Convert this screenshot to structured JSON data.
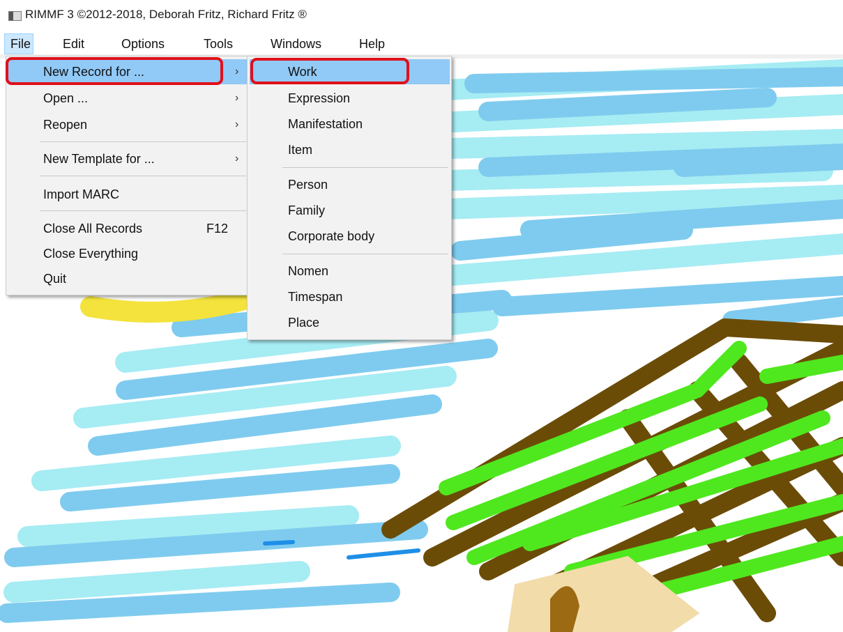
{
  "window": {
    "title": "RIMMF 3   ©2012-2018, Deborah Fritz, Richard Fritz ®"
  },
  "menubar": {
    "items": [
      "File",
      "Edit",
      "Options",
      "Tools",
      "Windows",
      "Help"
    ],
    "active": "File"
  },
  "file_menu": {
    "items": [
      {
        "label": "New Record for ...",
        "shortcut": "",
        "submenu": true,
        "highlighted": true
      },
      {
        "label": "Open ...",
        "shortcut": "",
        "submenu": true
      },
      {
        "label": "Reopen",
        "shortcut": "",
        "submenu": true
      },
      {
        "label": "New Template for ...",
        "shortcut": "",
        "submenu": true
      },
      {
        "label": "Import MARC",
        "shortcut": "",
        "submenu": false
      },
      {
        "label": "Close All Records",
        "shortcut": "F12",
        "submenu": false
      },
      {
        "label": "Close Everything",
        "shortcut": "",
        "submenu": false
      },
      {
        "label": "Quit",
        "shortcut": "",
        "submenu": false
      }
    ],
    "arrow_glyph": "›"
  },
  "new_record_submenu": {
    "items": [
      {
        "label": "Work",
        "highlighted": true
      },
      {
        "label": "Expression"
      },
      {
        "label": "Manifestation"
      },
      {
        "label": "Item"
      },
      {
        "label": "Person"
      },
      {
        "label": "Family"
      },
      {
        "label": "Corporate body"
      },
      {
        "label": "Nomen"
      },
      {
        "label": "Timespan"
      },
      {
        "label": "Place"
      }
    ]
  },
  "colors": {
    "menu_bg": "#f2f2f2",
    "highlight": "#91c9f7",
    "annotation_red": "#e0101a",
    "sky_light": "#9fe6f2",
    "sky_blue": "#7fcaf0",
    "sun": "#f5e33a",
    "roof_brown": "#6b4c07",
    "roof_green": "#4fe81e",
    "wall_beige": "#f2dcaa"
  }
}
